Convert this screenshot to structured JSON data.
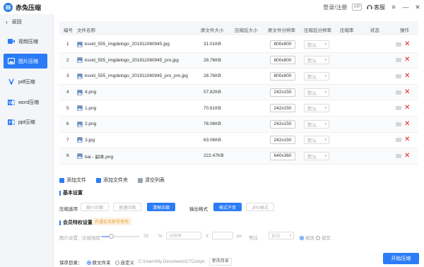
{
  "app": {
    "title": "赤兔压缩"
  },
  "titlebar": {
    "login": "登录/注册",
    "vip": "VIP",
    "service": "客服"
  },
  "sidebar": {
    "back": "返回",
    "items": [
      {
        "label": "视频压缩",
        "icon": "video-icon",
        "active": false
      },
      {
        "label": "图片压缩",
        "icon": "image-icon",
        "active": true
      },
      {
        "label": "pdf压缩",
        "icon": "pdf-icon",
        "active": false
      },
      {
        "label": "word压缩",
        "icon": "word-icon",
        "active": false
      },
      {
        "label": "ppt压缩",
        "icon": "ppt-icon",
        "active": false
      }
    ]
  },
  "table": {
    "headers": [
      "编号",
      "文件名称",
      "原文件大小",
      "压缩后大小",
      "原文件分辨率",
      "压缩后分辨率",
      "压缩率",
      "状态",
      "操作"
    ],
    "rows": [
      {
        "num": "1",
        "name": "ksvid_555_imgdelogo_201911080945.jpg",
        "size": "31.01KB",
        "res": "800x800",
        "target": "默认"
      },
      {
        "num": "2",
        "name": "ksvid_555_imgdelogo_201911080945_pro.jpg",
        "size": "28.76KB",
        "res": "800x800",
        "target": "默认"
      },
      {
        "num": "3",
        "name": "ksvid_555_imgdelogo_201911080945_pro_pro.jpg",
        "size": "28.76KB",
        "res": "800x800",
        "target": "默认"
      },
      {
        "num": "4",
        "name": "4.png",
        "size": "57.82KB",
        "res": "242x150",
        "target": "默认"
      },
      {
        "num": "5",
        "name": "1.png",
        "size": "70.61KB",
        "res": "242x150",
        "target": "默认"
      },
      {
        "num": "6",
        "name": "2.png",
        "size": "76.06KB",
        "res": "242x150",
        "target": "默认"
      },
      {
        "num": "7",
        "name": "3.jpg",
        "size": "63.06KB",
        "res": "242x150",
        "target": "默认"
      },
      {
        "num": "8",
        "name": "bai - 副本.png",
        "size": "222.47KB",
        "res": "640x360",
        "target": "默认"
      }
    ]
  },
  "toolbar": {
    "add_file": "添加文件",
    "add_folder": "添加文件夹",
    "clear": "清空列表"
  },
  "basic": {
    "title": "基本设置",
    "mode_label": "压缩选项",
    "modes": [
      "缩小压缩",
      "普通压缩",
      "清晰压缩"
    ],
    "active_mode": "清晰压缩",
    "format_label": "输出格式",
    "formats": [
      "格式不变",
      "JPG格式"
    ],
    "active_format": "格式不变"
  },
  "vip": {
    "title": "会员特权设置",
    "tag": "开通会员即可使用",
    "image_settings": "图片设置：",
    "quality_label": "压缩强度",
    "quality_value": "25",
    "quality_percent": 25,
    "percent": "%",
    "resolution_label": "分辨率",
    "x": "X",
    "px": "px",
    "scale_label": "等比",
    "scale_value": "自动",
    "radio1": "缩放",
    "radio2": "裁剪"
  },
  "bottom": {
    "save_label": "保存目录：",
    "opt1": "原文件夹",
    "opt2": "自定义",
    "path": "C:\\Users\\My Documents\\CTComps",
    "change": "更改目录",
    "start": "开始压缩"
  },
  "colors": {
    "accent": "#2b7cf6",
    "danger": "#e02020"
  }
}
